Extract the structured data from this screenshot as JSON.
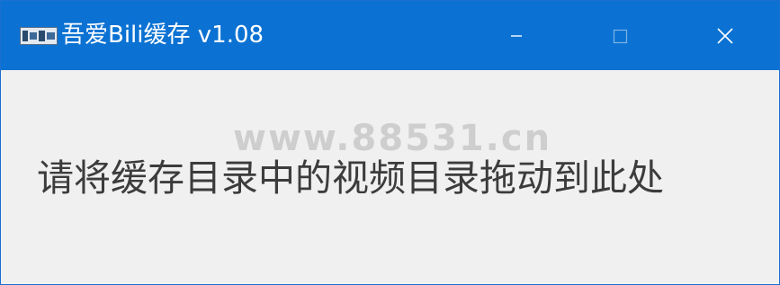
{
  "window": {
    "title": "吾爱Bili缓存 v1.08",
    "app_icon_label": "吾爱",
    "controls": {
      "minimize": "minimize",
      "maximize": "maximize",
      "close": "close"
    },
    "titlebar_color": "#0b72d3"
  },
  "main": {
    "watermark": "www.88531.cn",
    "drop_prompt": "请将缓存目录中的视频目录拖动到此处"
  }
}
